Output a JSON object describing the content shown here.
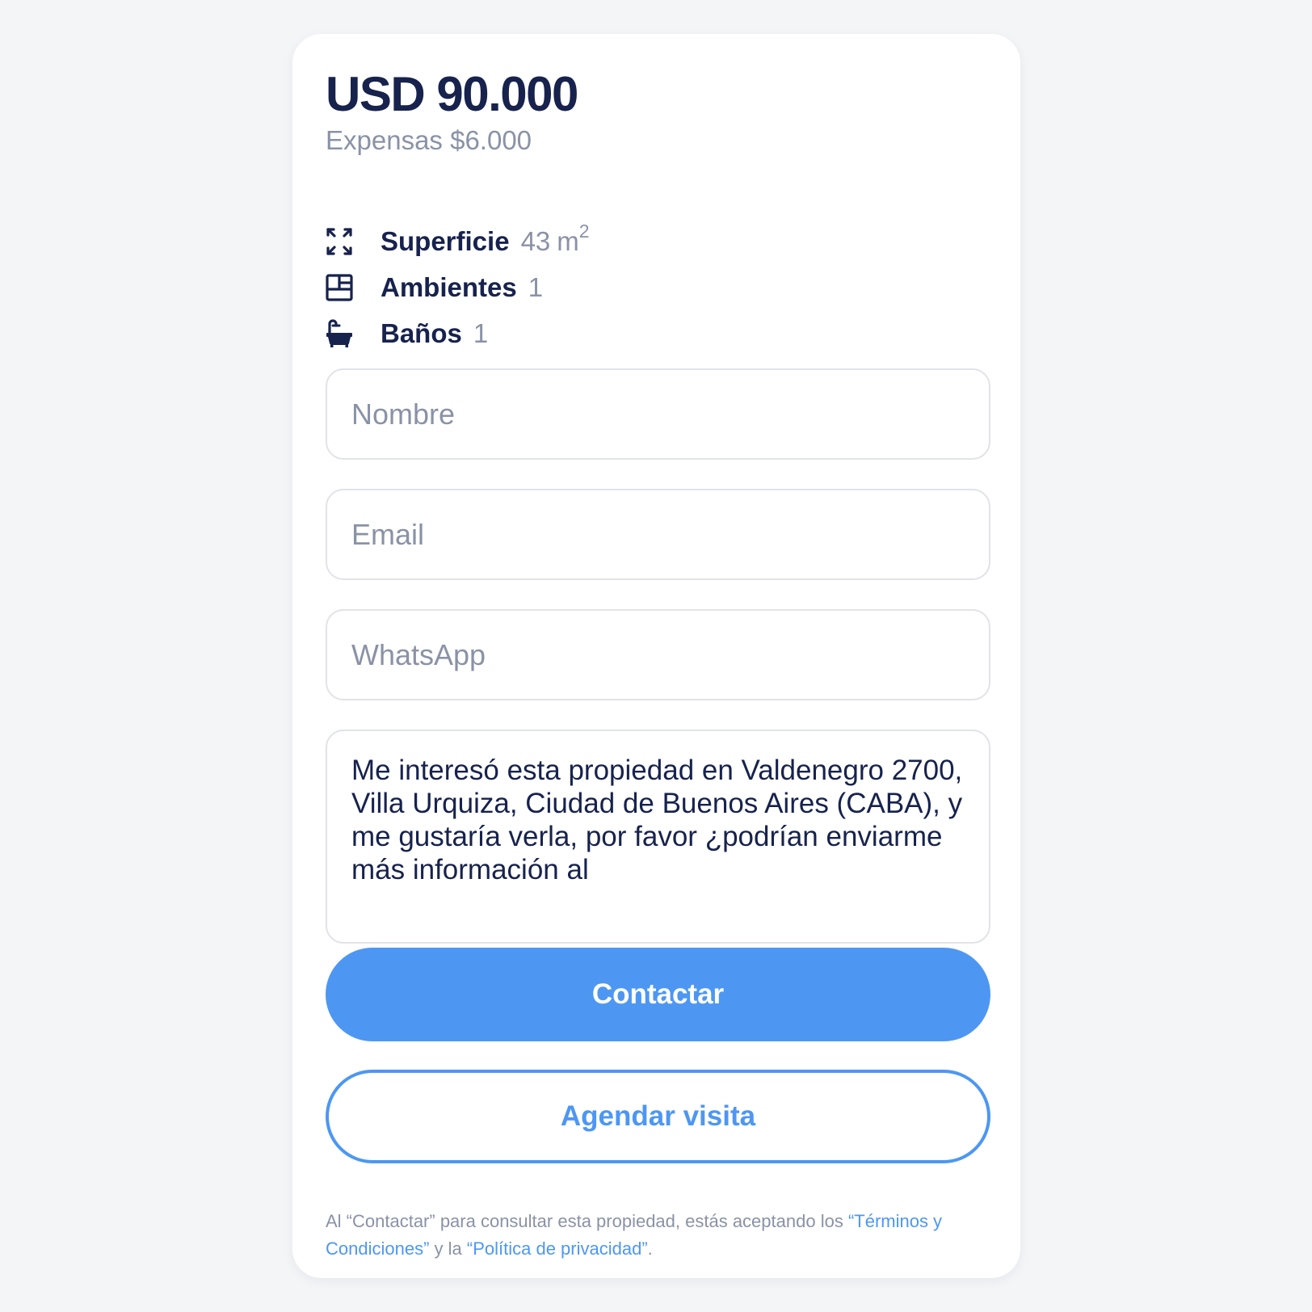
{
  "listing": {
    "price": "USD 90.000",
    "expensas": "Expensas $6.000"
  },
  "features": [
    {
      "icon": "expand-arrows-icon",
      "label": "Superficie",
      "value": "43",
      "unit": "m",
      "unit_sup": "2"
    },
    {
      "icon": "floor-plan-icon",
      "label": "Ambientes",
      "value": "1"
    },
    {
      "icon": "bathtub-icon",
      "label": "Baños",
      "value": "1"
    }
  ],
  "form": {
    "name_placeholder": "Nombre",
    "email_placeholder": "Email",
    "whatsapp_placeholder": "WhatsApp",
    "message_value": "Me interesó esta propiedad en Valdenegro 2700, Villa Urquiza, Ciudad de Buenos Aires (CABA), y me gustaría verla, por favor ¿podrían enviarme más información al"
  },
  "buttons": {
    "contact_label": "Contactar",
    "schedule_label": "Agendar visita"
  },
  "legal": {
    "prefix": "Al “Contactar” para consultar esta propiedad, estás aceptando los ",
    "terms_link": "“Términos y Condiciones”",
    "middle": " y la ",
    "privacy_link": "“Política de privacidad”",
    "suffix": "."
  },
  "colors": {
    "accent": "#4d97f3",
    "navy": "#17224d",
    "muted": "#8a92a6",
    "border": "#e1e3e8",
    "background": "#f4f5f7"
  }
}
